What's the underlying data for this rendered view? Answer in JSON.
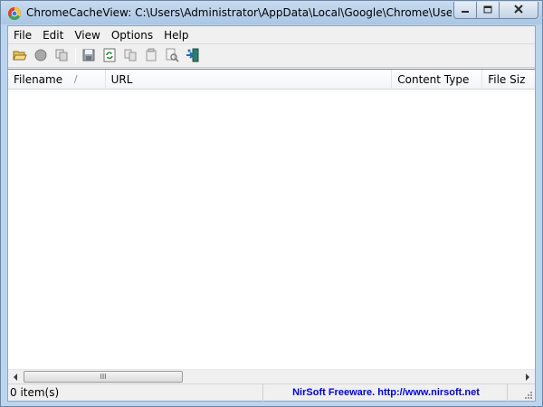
{
  "window": {
    "app_name": "ChromeCacheView:",
    "title": "C:\\Users\\Administrator\\AppData\\Local\\Google\\Chrome\\User D...",
    "icon": "chrome-cache-icon"
  },
  "caption": {
    "minimize_icon": "minimize-icon",
    "maximize_icon": "maximize-icon",
    "close_icon": "close-icon"
  },
  "menu": {
    "items": [
      {
        "label": "File"
      },
      {
        "label": "Edit"
      },
      {
        "label": "View"
      },
      {
        "label": "Options"
      },
      {
        "label": "Help"
      }
    ]
  },
  "toolbar": {
    "buttons": [
      {
        "icon": "open-folder-icon"
      },
      {
        "icon": "stop-icon"
      },
      {
        "icon": "copy-files-icon"
      },
      {
        "icon": "save-icon"
      },
      {
        "icon": "refresh-icon"
      },
      {
        "icon": "copy-icon"
      },
      {
        "icon": "properties-icon"
      },
      {
        "icon": "find-icon"
      },
      {
        "icon": "exit-icon"
      }
    ]
  },
  "list": {
    "columns": [
      {
        "label": "Filename",
        "sort": "/"
      },
      {
        "label": "URL"
      },
      {
        "label": "Content Type"
      },
      {
        "label": "File Siz"
      }
    ],
    "rows": []
  },
  "scrollbar": {
    "grip": "III"
  },
  "status": {
    "count": "0 item(s)",
    "link": "NirSoft Freeware.  http://www.nirsoft.net"
  },
  "colors": {
    "link": "#0000ee",
    "title_gradient_top": "#c7dbef",
    "title_gradient_bottom": "#aac6e4"
  }
}
